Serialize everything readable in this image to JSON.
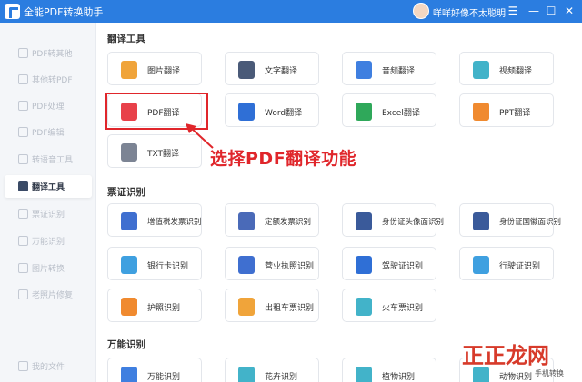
{
  "app": {
    "title": "全能PDF转换助手",
    "user_name": "咩咩好像不太聪明"
  },
  "window_controls": {
    "menu": "☰",
    "minimize": "—",
    "maximize": "☐",
    "close": "✕"
  },
  "sidebar": {
    "items": [
      {
        "label": "PDF转其他",
        "active": false
      },
      {
        "label": "其他转PDF",
        "active": false
      },
      {
        "label": "PDF处理",
        "active": false
      },
      {
        "label": "PDF编辑",
        "active": false
      },
      {
        "label": "转语音工具",
        "active": false
      },
      {
        "label": "翻译工具",
        "active": true
      },
      {
        "label": "票证识别",
        "active": false
      },
      {
        "label": "万能识别",
        "active": false
      },
      {
        "label": "图片转换",
        "active": false
      },
      {
        "label": "老照片修复",
        "active": false
      }
    ],
    "bottom_item": {
      "label": "我的文件"
    }
  },
  "sections": {
    "translate": {
      "title": "翻译工具",
      "cards": [
        {
          "label": "图片翻译",
          "icon": "image-icon",
          "color": "#f0a43a"
        },
        {
          "label": "文字翻译",
          "icon": "text-icon",
          "color": "#4a5a78"
        },
        {
          "label": "音频翻译",
          "icon": "audio-icon",
          "color": "#3f7fe0"
        },
        {
          "label": "视频翻译",
          "icon": "video-icon",
          "color": "#42b3c9"
        },
        {
          "label": "PDF翻译",
          "icon": "pdf-icon",
          "color": "#e8414a"
        },
        {
          "label": "Word翻译",
          "icon": "word-icon",
          "color": "#2f6fd6"
        },
        {
          "label": "Excel翻译",
          "icon": "excel-icon",
          "color": "#2fa85a"
        },
        {
          "label": "PPT翻译",
          "icon": "ppt-icon",
          "color": "#f08a2f"
        },
        {
          "label": "TXT翻译",
          "icon": "txt-icon",
          "color": "#7c8494"
        }
      ]
    },
    "ticket": {
      "title": "票证识别",
      "cards": [
        {
          "label": "增值税发票识别",
          "icon": "invoice-icon",
          "color": "#3f6fd0"
        },
        {
          "label": "定额发票识别",
          "icon": "receipt-icon",
          "color": "#4a6ab8"
        },
        {
          "label": "身份证头像面识别",
          "icon": "id-card-front-icon",
          "color": "#3a5a9a"
        },
        {
          "label": "身份证国徽面识别",
          "icon": "id-card-back-icon",
          "color": "#3a5a9a"
        },
        {
          "label": "银行卡识别",
          "icon": "bank-card-icon",
          "color": "#3fa0e0"
        },
        {
          "label": "营业执照识别",
          "icon": "license-icon",
          "color": "#3f6fd0"
        },
        {
          "label": "驾驶证识别",
          "icon": "driver-license-icon",
          "color": "#2f6fd6"
        },
        {
          "label": "行驶证识别",
          "icon": "vehicle-license-icon",
          "color": "#3fa0e0"
        },
        {
          "label": "护照识别",
          "icon": "passport-icon",
          "color": "#f08a2f"
        },
        {
          "label": "出租车票识别",
          "icon": "taxi-icon",
          "color": "#f0a43a"
        },
        {
          "label": "火车票识别",
          "icon": "train-ticket-icon",
          "color": "#42b3c9"
        }
      ]
    },
    "universal": {
      "title": "万能识别",
      "cards": [
        {
          "label": "万能识别",
          "icon": "eye-icon",
          "color": "#3f7fe0"
        },
        {
          "label": "花卉识别",
          "icon": "flower-icon",
          "color": "#42b3c9"
        },
        {
          "label": "植物识别",
          "icon": "plant-icon",
          "color": "#42b3c9"
        },
        {
          "label": "动物识别",
          "icon": "animal-icon",
          "color": "#42b3c9"
        }
      ]
    }
  },
  "annotation": {
    "callout": "选择PDF翻译功能"
  },
  "watermark": {
    "text": "正正龙网",
    "sub": "手机转换"
  }
}
